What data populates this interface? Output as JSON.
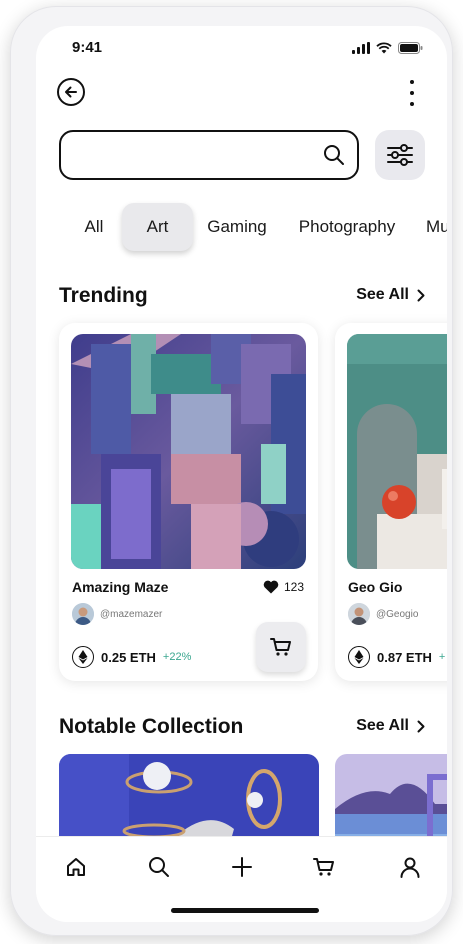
{
  "status_bar": {
    "time": "9:41"
  },
  "search": {
    "value": "",
    "placeholder": ""
  },
  "categories": [
    {
      "label": "All",
      "active": false
    },
    {
      "label": "Art",
      "active": true
    },
    {
      "label": "Gaming",
      "active": false
    },
    {
      "label": "Photography",
      "active": false
    },
    {
      "label": "Mu",
      "active": false
    }
  ],
  "trending": {
    "title": "Trending",
    "see_all": "See All",
    "items": [
      {
        "name": "Amazing Maze",
        "likes": "123",
        "creator": "@mazemazer",
        "price": "0.25 ETH",
        "change": "+22%"
      },
      {
        "name": "Geo Gio",
        "creator": "@Geogio",
        "price": "0.87 ETH",
        "change": "+"
      }
    ]
  },
  "notable": {
    "title": "Notable Collection",
    "see_all": "See All"
  },
  "colors": {
    "accent_green": "#3aa68f",
    "chip_bg": "#e9e9ec"
  },
  "icons": [
    "back-arrow-icon",
    "more-vertical-icon",
    "search-icon",
    "filter-icon",
    "chevron-right-icon",
    "heart-icon",
    "ethereum-icon",
    "cart-icon",
    "home-icon",
    "plus-icon",
    "user-icon"
  ]
}
